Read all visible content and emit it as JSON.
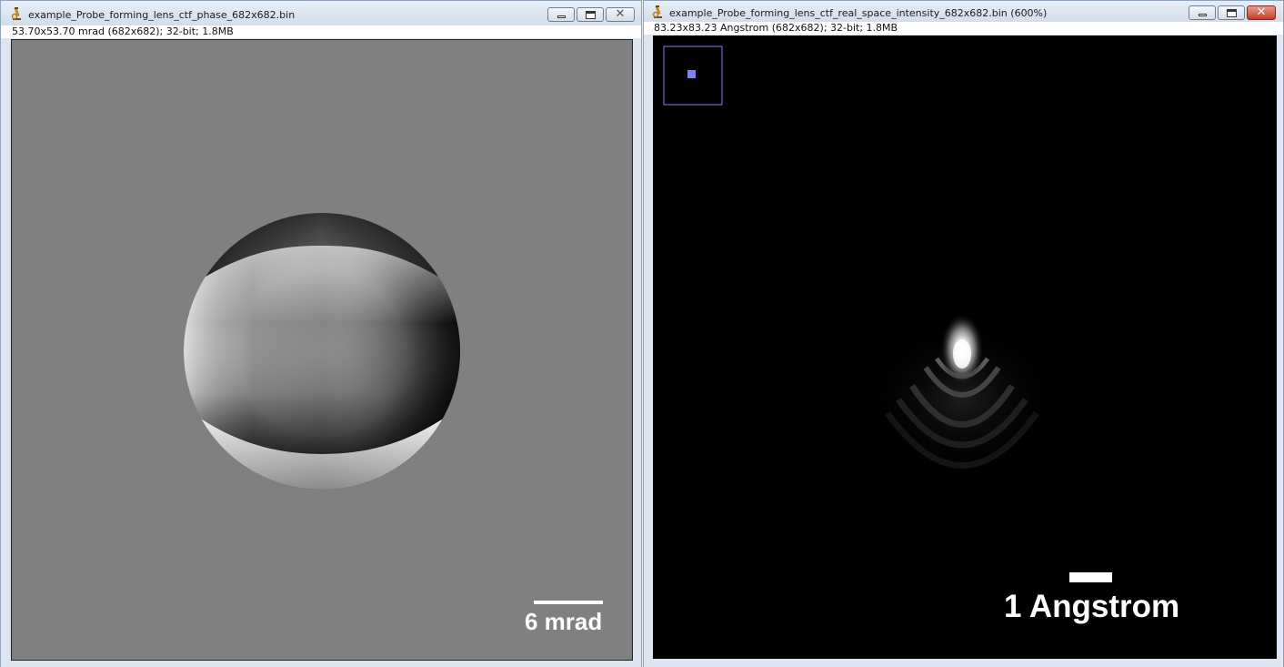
{
  "windows": [
    {
      "title": "example_Probe_forming_lens_ctf_phase_682x682.bin",
      "info": "53.70x53.70 mrad (682x682); 32-bit; 1.8MB",
      "scale_bar_label": "6 mrad"
    },
    {
      "title": "example_Probe_forming_lens_ctf_real_space_intensity_682x682.bin (600%)",
      "info": "83.23x83.23 Angstrom (682x682); 32-bit; 1.8MB",
      "scale_bar_label": "1 Angstrom"
    }
  ],
  "icons": {
    "app": "microscope-icon",
    "minimize": "minimize-icon",
    "maximize": "maximize-icon",
    "close": "close-icon"
  },
  "colors": {
    "phase_background": "#808080",
    "intensity_background": "#000000",
    "navigator_outline": "#8080ff",
    "close_button": "#c0412b",
    "scale_bar": "#ffffff"
  }
}
